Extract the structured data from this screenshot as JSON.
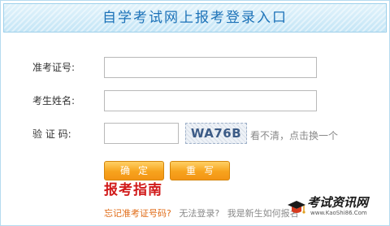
{
  "header": {
    "title": "自学考试网上报考登录入口"
  },
  "form": {
    "exam_id_label": "准考证号:",
    "exam_id_value": "",
    "name_label": "考生姓名:",
    "name_value": "",
    "captcha_label": "验 证 码:",
    "captcha_value": "",
    "captcha_code": "WA76B",
    "refresh_text": "看不清，点击换一个",
    "confirm_label": "确定",
    "reset_label": "重写"
  },
  "guide": {
    "text": "报考指南"
  },
  "links": {
    "forgot": "忘记准考证号码?",
    "cannot_login": "无法登录?",
    "new_student": "我是新生如何报名"
  },
  "watermark": {
    "brand": "考试资讯网",
    "url": "www.KaoShi86.Com"
  },
  "colors": {
    "title": "#1c72b8",
    "button": "#f7a31d",
    "guide": "#d11a1a",
    "forgot_link": "#e06c17"
  }
}
